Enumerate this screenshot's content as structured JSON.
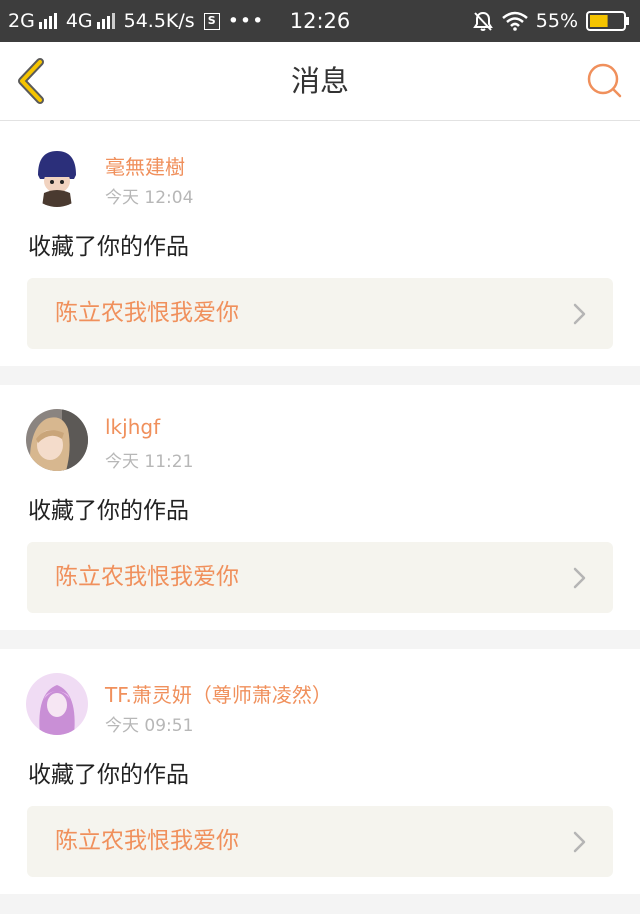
{
  "status_bar": {
    "network1": "2G",
    "network2": "4G",
    "speed": "54.5K/s",
    "s_icon_label": "S",
    "dots": "•••",
    "time": "12:26",
    "battery": "55%",
    "battery_level": 0.55,
    "icons": [
      "signal-icon",
      "signal-icon",
      "s-box-icon",
      "mute-bell-icon",
      "wifi-icon",
      "battery-icon"
    ]
  },
  "navbar": {
    "title": "消息",
    "accent_color": "#f0905c",
    "back_icon": "chevron-left-icon",
    "search_icon": "search-icon"
  },
  "messages": [
    {
      "username": "毫無建樹",
      "time": "今天 12:04",
      "action": "收藏了你的作品",
      "work_title": "陈立农我恨我爱你"
    },
    {
      "username": "lkjhgf",
      "time": "今天 11:21",
      "action": "收藏了你的作品",
      "work_title": "陈立农我恨我爱你"
    },
    {
      "username": "TF.萧灵妍（尊师萧凌然）",
      "time": "今天 09:51",
      "action": "收藏了你的作品",
      "work_title": "陈立农我恨我爱你"
    }
  ]
}
